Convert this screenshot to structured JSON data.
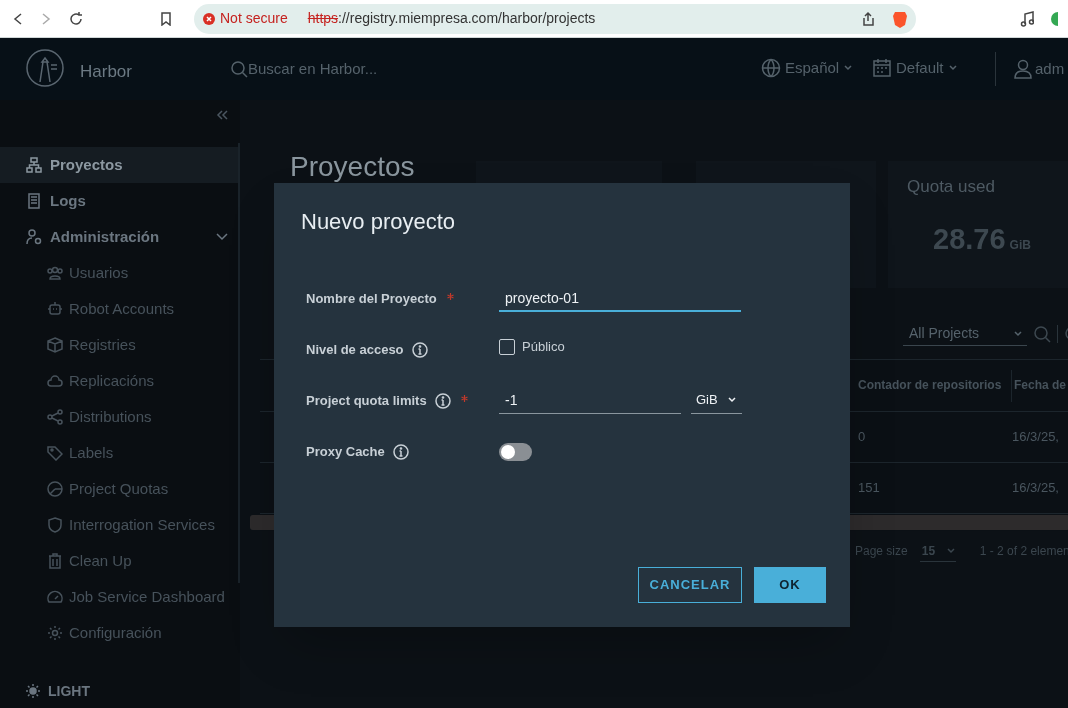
{
  "browser": {
    "security": "Not secure",
    "url_scheme": "https",
    "url_rest": "://registry.miempresa.com/harbor/projects"
  },
  "header": {
    "app_name": "Harbor",
    "search_placeholder": "Buscar en Harbor...",
    "language": "Español",
    "scope": "Default",
    "user": "adm"
  },
  "sidebar": {
    "items": [
      {
        "label": "Proyectos",
        "selected": true
      },
      {
        "label": "Logs",
        "selected": false
      },
      {
        "label": "Administración",
        "selected": false,
        "expanded": true,
        "children": [
          {
            "label": "Usuarios",
            "selected": false
          },
          {
            "label": "Robot Accounts",
            "selected": false
          },
          {
            "label": "Registries",
            "selected": false
          },
          {
            "label": "Replicacións",
            "selected": false
          },
          {
            "label": "Distributions",
            "selected": false
          },
          {
            "label": "Labels",
            "selected": false
          },
          {
            "label": "Project Quotas",
            "selected": false
          },
          {
            "label": "Interrogation Services",
            "selected": false
          },
          {
            "label": "Clean Up",
            "selected": false
          },
          {
            "label": "Job Service Dashboard",
            "selected": false
          },
          {
            "label": "Configuración",
            "selected": false
          }
        ]
      }
    ],
    "theme_toggle": "LIGHT"
  },
  "page": {
    "title": "Proyectos",
    "cards": [
      {
        "kind": "blank"
      },
      {
        "kind": "blank"
      },
      {
        "kind": "quota",
        "label": "Quota used",
        "value": "28.76",
        "unit": "GiB"
      }
    ],
    "filter": "All Projects",
    "table": {
      "columns": [
        "Contador de repositorios",
        "Fecha de"
      ],
      "rows": [
        [
          "0",
          "16/3/25,"
        ],
        [
          "151",
          "16/3/25,"
        ]
      ]
    },
    "pagination": {
      "page_size_label": "Page size",
      "page_size": "15",
      "range": "1 - 2 of 2 elemen"
    }
  },
  "dialog": {
    "title": "Nuevo proyecto",
    "fields": [
      {
        "kind": "text",
        "label": "Nombre del Proyecto",
        "required": true,
        "info": false,
        "value": "proyecto-01",
        "focused": true
      },
      {
        "kind": "checkbox",
        "label": "Nivel de acceso",
        "required": false,
        "info": true,
        "option": "Público",
        "checked": false
      },
      {
        "kind": "quota",
        "label": "Project quota limits",
        "required": true,
        "info": true,
        "value": "-1",
        "unit": "GiB"
      },
      {
        "kind": "toggle",
        "label": "Proxy Cache",
        "required": false,
        "info": true,
        "on": false
      }
    ],
    "buttons": [
      {
        "label": "CANCELAR",
        "kind": "secondary"
      },
      {
        "label": "OK",
        "kind": "primary"
      }
    ]
  }
}
